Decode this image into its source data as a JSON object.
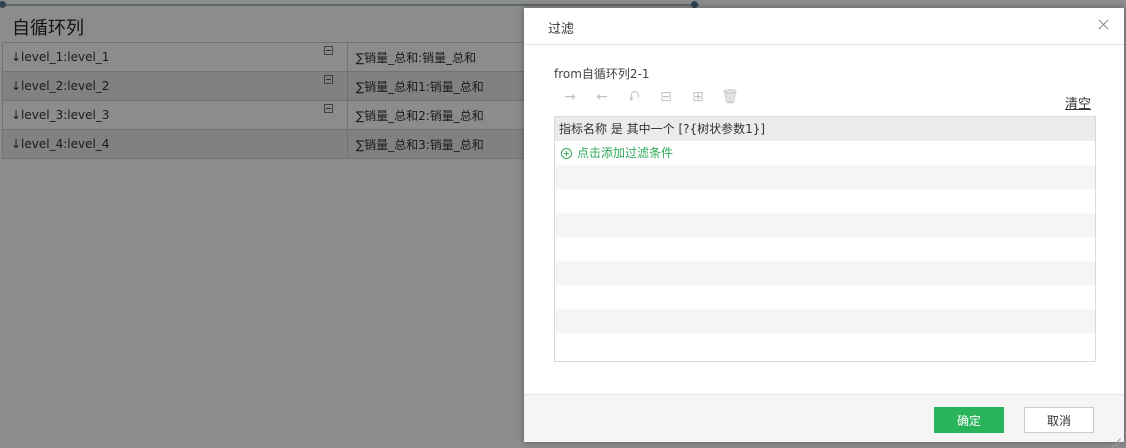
{
  "background": {
    "title": "自循环列",
    "rows": [
      {
        "level": "↓level_1:level_1",
        "measure": "∑销量_总和:销量_总和",
        "collapsible": true
      },
      {
        "level": "↓level_2:level_2",
        "measure": "∑销量_总和1:销量_总和",
        "collapsible": true
      },
      {
        "level": "↓level_3:level_3",
        "measure": "∑销量_总和2:销量_总和",
        "collapsible": true
      },
      {
        "level": "↓level_4:level_4",
        "measure": "∑销量_总和3:销量_总和",
        "collapsible": false
      }
    ]
  },
  "dialog": {
    "title": "过滤",
    "source": "from自循环列2-1",
    "toolbar": [
      {
        "name": "indent-right-icon",
        "glyph": "→"
      },
      {
        "name": "indent-left-icon",
        "glyph": "←"
      },
      {
        "name": "swap-icon",
        "glyph": "⮏"
      },
      {
        "name": "insert-before-icon",
        "glyph": "⊟"
      },
      {
        "name": "insert-after-icon",
        "glyph": "⊞"
      },
      {
        "name": "delete-icon",
        "glyph": "🗑"
      }
    ],
    "clear_label": "清空",
    "condition": "指标名称 是 其中一个 [?{树状参数1}]",
    "add_condition_label": "点击添加过滤条件",
    "ok_label": "确定",
    "cancel_label": "取消"
  },
  "colors": {
    "accent": "#29b35a",
    "link_green": "#2eaa5a"
  }
}
